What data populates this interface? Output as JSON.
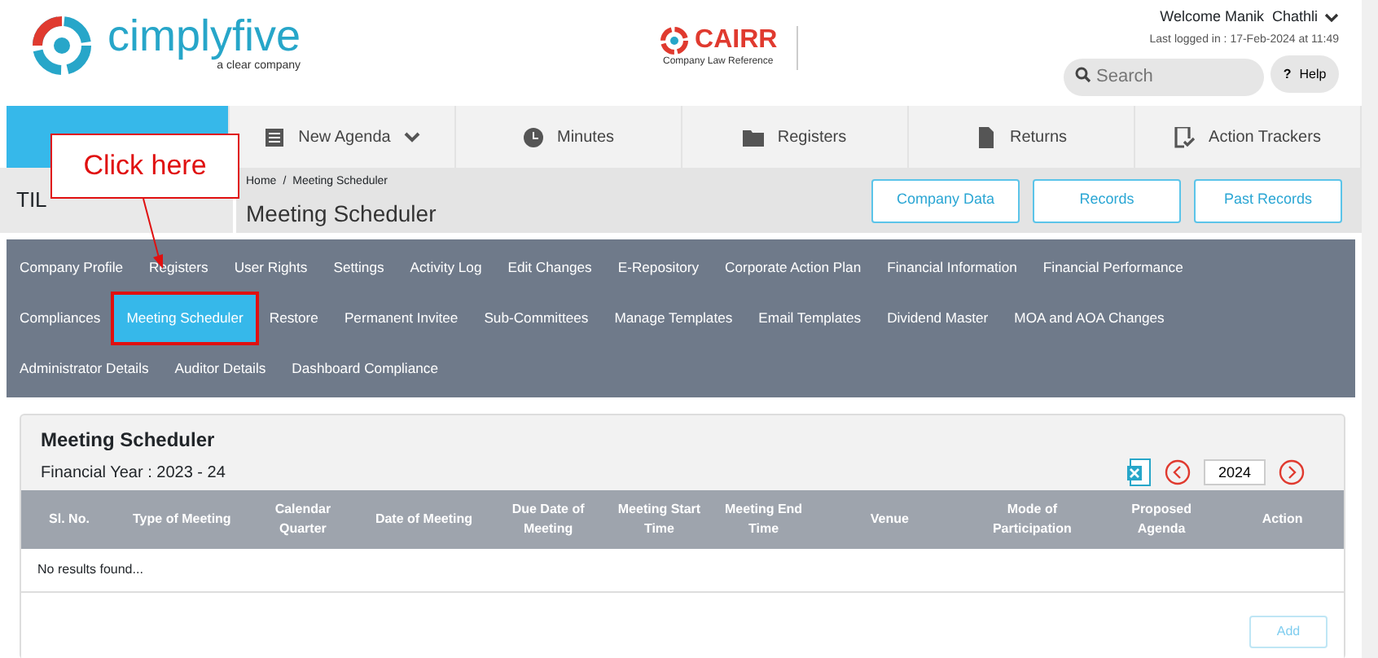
{
  "header": {
    "welcome": "Welcome Manik  Chathli",
    "last_login": "Last logged in : 17-Feb-2024 at 11:49",
    "search_placeholder": "Search",
    "help": "Help",
    "help_icon": "?",
    "brand": "cimplyfive",
    "brand_sub": "a clear company",
    "cairr": "CAIRR",
    "cairr_sub": "Company Law Reference"
  },
  "tabs": [
    {
      "selected": true,
      "kind": "plain"
    },
    {
      "label": "New Agenda",
      "selected": false,
      "kind": "dropdown"
    },
    {
      "label": "Minutes",
      "selected": false,
      "kind": "clock"
    },
    {
      "label": "Registers",
      "selected": false,
      "kind": "folder"
    },
    {
      "label": "Returns",
      "selected": false,
      "kind": "doc"
    },
    {
      "label": "Action Trackers",
      "selected": false,
      "kind": "check"
    }
  ],
  "company": "TIL",
  "breadcrumb": [
    "Home",
    "Meeting Scheduler"
  ],
  "breadcrumb_separator": "/",
  "page_title": "Meeting Scheduler",
  "top_buttons": [
    "Company Data",
    "Records",
    "Past Records"
  ],
  "menu": [
    [
      {
        "label": "Company Profile",
        "selected": false
      },
      {
        "label": "Registers",
        "selected": false
      },
      {
        "label": "User Rights",
        "selected": false
      },
      {
        "label": "Settings",
        "selected": false
      },
      {
        "label": "Activity Log",
        "selected": false
      },
      {
        "label": "Edit Changes",
        "selected": false
      },
      {
        "label": "E-Repository",
        "selected": false
      },
      {
        "label": "Corporate Action Plan",
        "selected": false
      },
      {
        "label": "Financial Information",
        "selected": false
      },
      {
        "label": "Financial Performance",
        "selected": false
      }
    ],
    [
      {
        "label": "Compliances",
        "selected": false
      },
      {
        "label": "Meeting Scheduler",
        "selected": true
      },
      {
        "label": "Restore",
        "selected": false
      },
      {
        "label": "Permanent Invitee",
        "selected": false
      },
      {
        "label": "Sub-Committees",
        "selected": false
      },
      {
        "label": "Manage Templates",
        "selected": false
      },
      {
        "label": "Email Templates",
        "selected": false
      },
      {
        "label": "Dividend Master",
        "selected": false
      },
      {
        "label": "MOA and AOA Changes",
        "selected": false
      }
    ],
    [
      {
        "label": "Administrator Details",
        "selected": false
      },
      {
        "label": "Auditor Details",
        "selected": false
      },
      {
        "label": "Dashboard Compliance",
        "selected": false
      }
    ]
  ],
  "panel": {
    "title": "Meeting Scheduler",
    "financial_year": "Financial Year : 2023 - 24",
    "year": "2024",
    "columns": [
      "Sl. No.",
      "Type of Meeting",
      "Calendar Quarter",
      "Date of Meeting",
      "Due Date of Meeting",
      "Meeting Start Time",
      "Meeting End Time",
      "Venue",
      "Mode of Participation",
      "Proposed Agenda",
      "Action"
    ],
    "empty": "No results found...",
    "add": "Add"
  },
  "callout": "Click here"
}
